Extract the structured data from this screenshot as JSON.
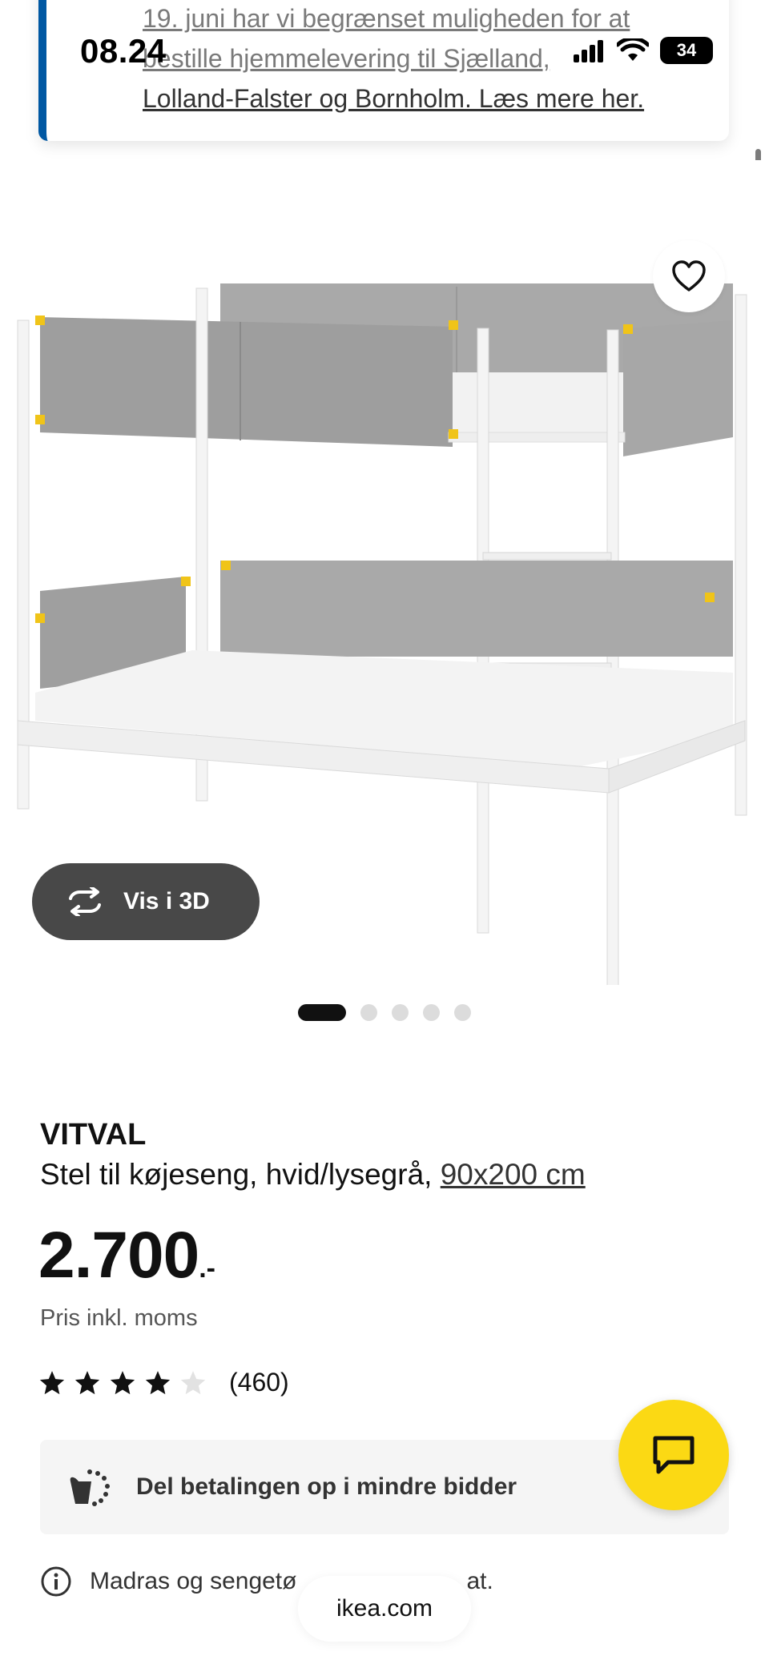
{
  "status_bar": {
    "time": "08.24",
    "battery_level": "34"
  },
  "notice": {
    "line1": "19. juni har vi begrænset muligheden for at",
    "line2": "bestille hjemmelevering til Sjælland,",
    "line3": "Lolland-Falster og Bornholm. Læs mere her."
  },
  "gallery": {
    "view3d_label": "Vis i 3D",
    "slide_count": 5,
    "active_slide": 1
  },
  "product": {
    "brand": "VITVAL",
    "description": "Stel til køjeseng, hvid/lysegrå,",
    "size_link": "90x200 cm",
    "price": "2.700",
    "price_suffix": ".-",
    "vat_note": "Pris inkl. moms",
    "rating": 4,
    "rating_max": 5,
    "rating_count": "(460)"
  },
  "installment": {
    "label": "Del betalingen op i mindre bidder"
  },
  "info": {
    "text_start": "Madras og sengetø",
    "text_end": "at."
  },
  "browser": {
    "url": "ikea.com"
  },
  "colors": {
    "accent_blue": "#0058a3",
    "chat_yellow": "#fbd914",
    "button_dark": "#484848"
  }
}
